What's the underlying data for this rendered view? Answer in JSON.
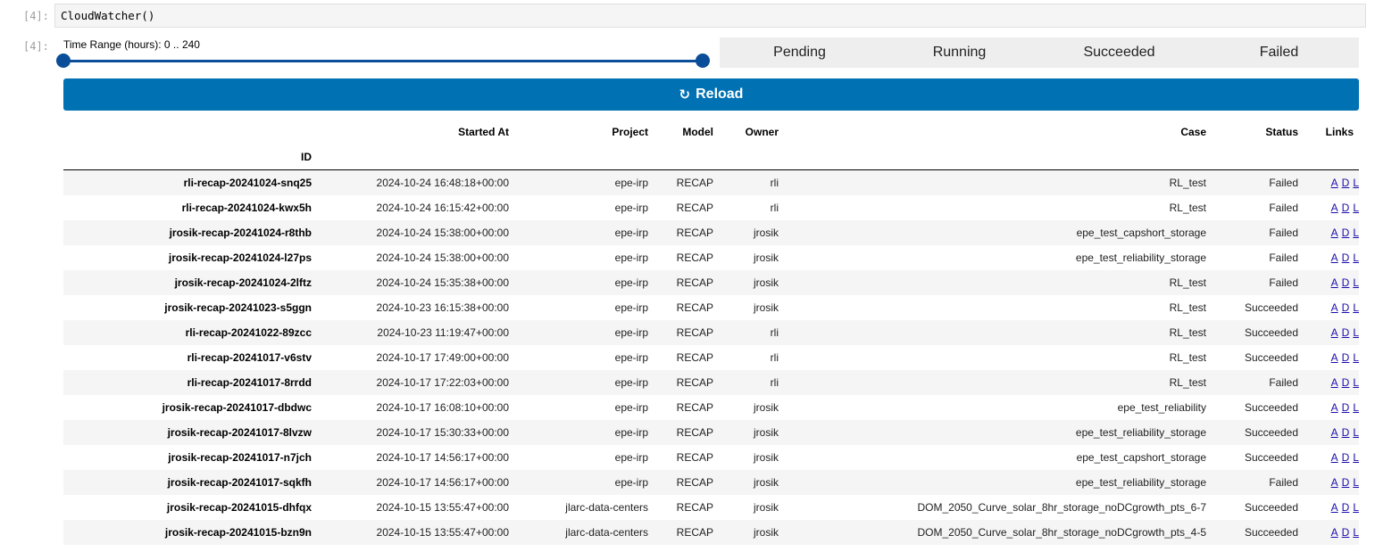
{
  "cell": {
    "input_prompt": "[4]:",
    "code": "CloudWatcher()",
    "output_prompt": "[4]:"
  },
  "slider": {
    "label": "Time Range (hours): 0 .. 240",
    "min": 0,
    "max": 240,
    "low": 0,
    "high": 240
  },
  "status_bar": [
    "Pending",
    "Running",
    "Succeeded",
    "Failed"
  ],
  "reload": {
    "icon": "refresh-icon",
    "label": "Reload"
  },
  "table": {
    "columns": [
      "Started At",
      "Project",
      "Model",
      "Owner",
      "Case",
      "Status",
      "Links"
    ],
    "index_header": "ID",
    "rows": [
      {
        "id": "rli-recap-20241024-snq25",
        "started": "2024-10-24 16:48:18+00:00",
        "project": "epe-irp",
        "model": "RECAP",
        "owner": "rli",
        "case": "RL_test",
        "status": "Failed"
      },
      {
        "id": "rli-recap-20241024-kwx5h",
        "started": "2024-10-24 16:15:42+00:00",
        "project": "epe-irp",
        "model": "RECAP",
        "owner": "rli",
        "case": "RL_test",
        "status": "Failed"
      },
      {
        "id": "jrosik-recap-20241024-r8thb",
        "started": "2024-10-24 15:38:00+00:00",
        "project": "epe-irp",
        "model": "RECAP",
        "owner": "jrosik",
        "case": "epe_test_capshort_storage",
        "status": "Failed"
      },
      {
        "id": "jrosik-recap-20241024-l27ps",
        "started": "2024-10-24 15:38:00+00:00",
        "project": "epe-irp",
        "model": "RECAP",
        "owner": "jrosik",
        "case": "epe_test_reliability_storage",
        "status": "Failed"
      },
      {
        "id": "jrosik-recap-20241024-2lftz",
        "started": "2024-10-24 15:35:38+00:00",
        "project": "epe-irp",
        "model": "RECAP",
        "owner": "jrosik",
        "case": "RL_test",
        "status": "Failed"
      },
      {
        "id": "jrosik-recap-20241023-s5ggn",
        "started": "2024-10-23 16:15:38+00:00",
        "project": "epe-irp",
        "model": "RECAP",
        "owner": "jrosik",
        "case": "RL_test",
        "status": "Succeeded"
      },
      {
        "id": "rli-recap-20241022-89zcc",
        "started": "2024-10-23 11:19:47+00:00",
        "project": "epe-irp",
        "model": "RECAP",
        "owner": "rli",
        "case": "RL_test",
        "status": "Succeeded"
      },
      {
        "id": "rli-recap-20241017-v6stv",
        "started": "2024-10-17 17:49:00+00:00",
        "project": "epe-irp",
        "model": "RECAP",
        "owner": "rli",
        "case": "RL_test",
        "status": "Succeeded"
      },
      {
        "id": "rli-recap-20241017-8rrdd",
        "started": "2024-10-17 17:22:03+00:00",
        "project": "epe-irp",
        "model": "RECAP",
        "owner": "rli",
        "case": "RL_test",
        "status": "Failed"
      },
      {
        "id": "jrosik-recap-20241017-dbdwc",
        "started": "2024-10-17 16:08:10+00:00",
        "project": "epe-irp",
        "model": "RECAP",
        "owner": "jrosik",
        "case": "epe_test_reliability",
        "status": "Succeeded"
      },
      {
        "id": "jrosik-recap-20241017-8lvzw",
        "started": "2024-10-17 15:30:33+00:00",
        "project": "epe-irp",
        "model": "RECAP",
        "owner": "jrosik",
        "case": "epe_test_reliability_storage",
        "status": "Succeeded"
      },
      {
        "id": "jrosik-recap-20241017-n7jch",
        "started": "2024-10-17 14:56:17+00:00",
        "project": "epe-irp",
        "model": "RECAP",
        "owner": "jrosik",
        "case": "epe_test_capshort_storage",
        "status": "Succeeded"
      },
      {
        "id": "jrosik-recap-20241017-sqkfh",
        "started": "2024-10-17 14:56:17+00:00",
        "project": "epe-irp",
        "model": "RECAP",
        "owner": "jrosik",
        "case": "epe_test_reliability_storage",
        "status": "Failed"
      },
      {
        "id": "jrosik-recap-20241015-dhfqx",
        "started": "2024-10-15 13:55:47+00:00",
        "project": "jlarc-data-centers",
        "model": "RECAP",
        "owner": "jrosik",
        "case": "DOM_2050_Curve_solar_8hr_storage_noDCgrowth_pts_6-7",
        "status": "Succeeded"
      },
      {
        "id": "jrosik-recap-20241015-bzn9n",
        "started": "2024-10-15 13:55:47+00:00",
        "project": "jlarc-data-centers",
        "model": "RECAP",
        "owner": "jrosik",
        "case": "DOM_2050_Curve_solar_8hr_storage_noDCgrowth_pts_4-5",
        "status": "Succeeded"
      }
    ],
    "links": [
      "A",
      "D",
      "L"
    ]
  }
}
